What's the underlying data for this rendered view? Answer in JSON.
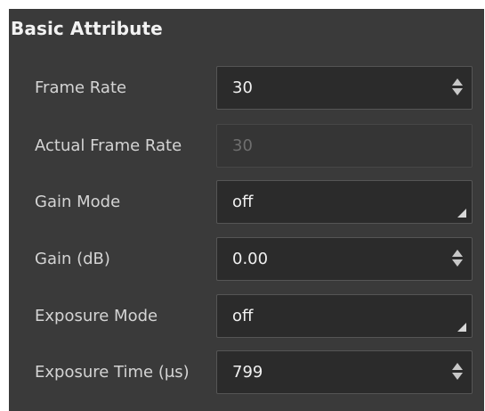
{
  "panel": {
    "title": "Basic Attribute",
    "rows": [
      {
        "label": "Frame Rate",
        "value": "30",
        "control": "spinbox",
        "enabled": true
      },
      {
        "label": "Actual Frame Rate",
        "value": "30",
        "control": "readonly",
        "enabled": false
      },
      {
        "label": "Gain Mode",
        "value": "off",
        "control": "combobox",
        "enabled": true
      },
      {
        "label": "Gain (dB)",
        "value": "0.00",
        "control": "spinbox",
        "enabled": true
      },
      {
        "label": "Exposure Mode",
        "value": "off",
        "control": "combobox",
        "enabled": true
      },
      {
        "label": "Exposure Time (μs)",
        "value": "799",
        "control": "spinbox",
        "enabled": true
      }
    ]
  },
  "icons": {
    "spinbox": "up-down-arrows-icon",
    "combobox": "dropdown-corner-icon"
  },
  "colors": {
    "panel_background": "#3a3a3a",
    "field_background": "#2b2b2b",
    "field_border": "#555555",
    "text": "#e6e6e6",
    "disabled_text": "#6e6e6e"
  }
}
